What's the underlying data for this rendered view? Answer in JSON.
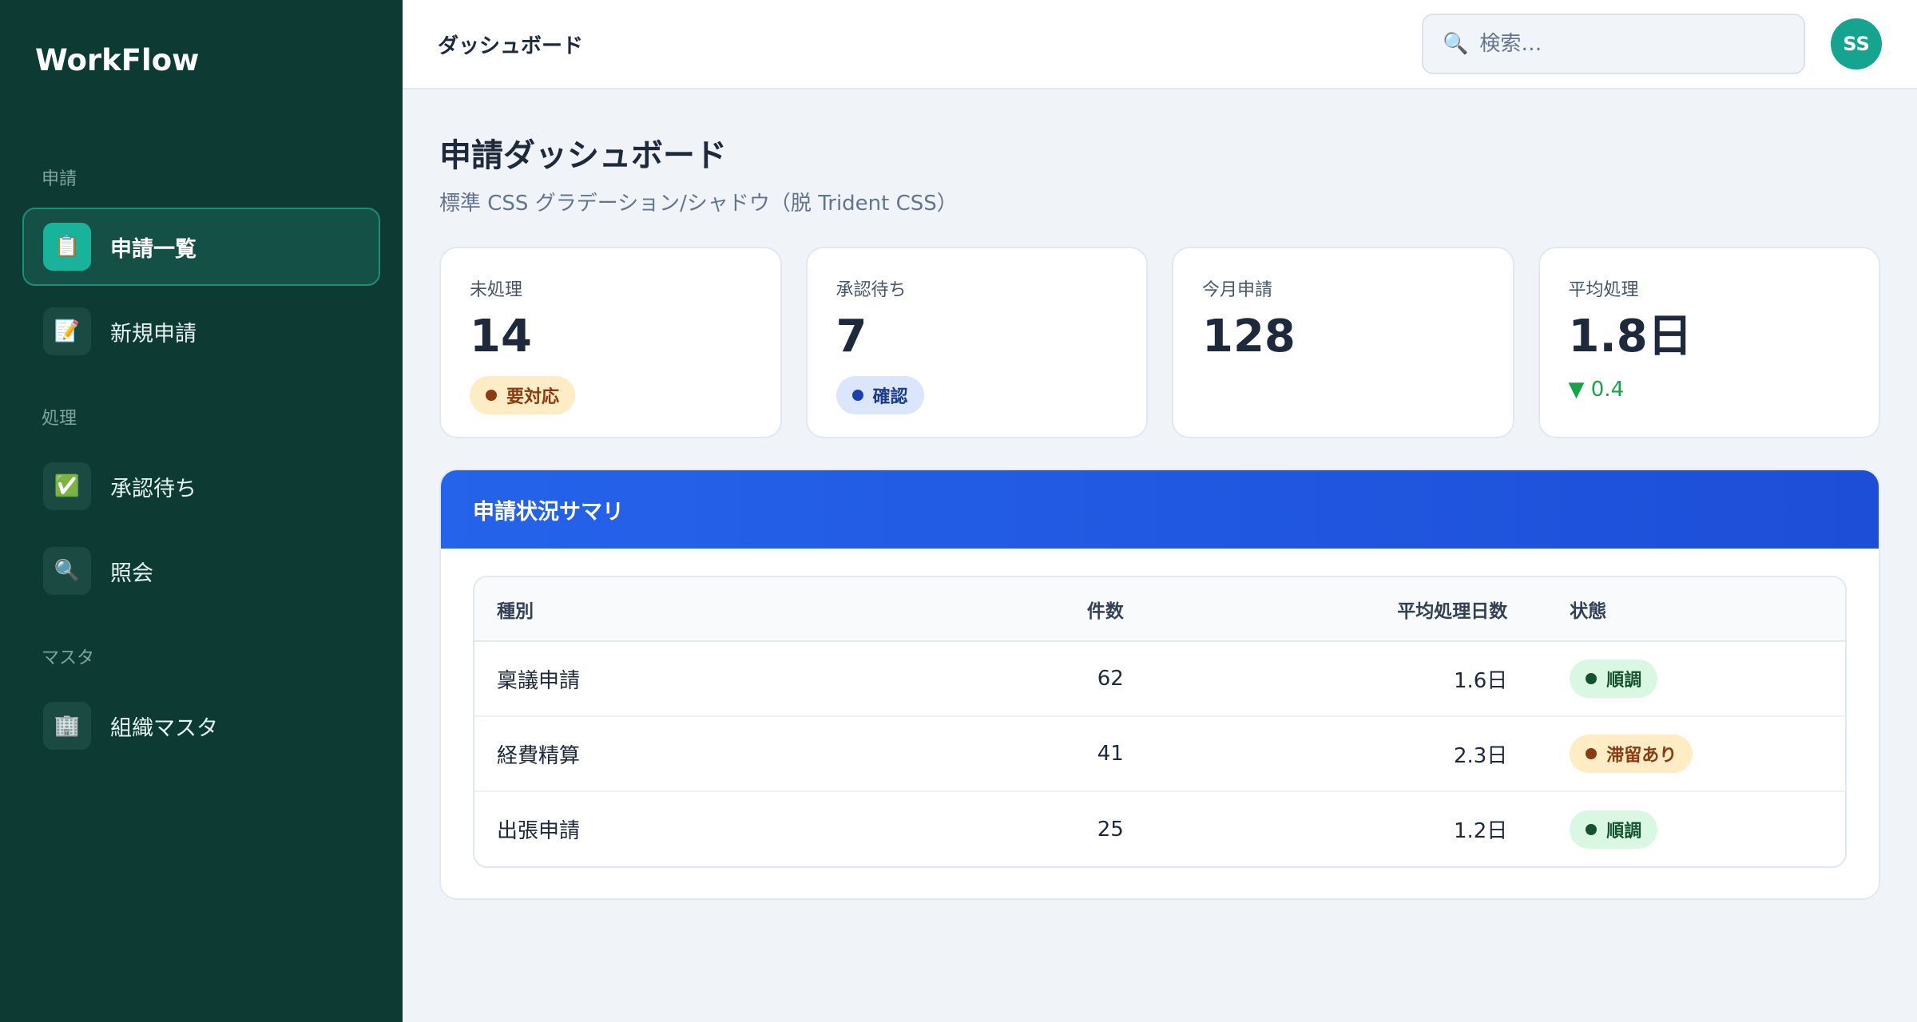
{
  "sidebar": {
    "brand": "WorkFlow",
    "sections": [
      {
        "title": "申請",
        "items": [
          {
            "icon": "📋",
            "icon_name": "clipboard-icon",
            "label": "申請一覧",
            "active": true
          },
          {
            "icon": "📝",
            "icon_name": "memo-icon",
            "label": "新規申請",
            "active": false
          }
        ]
      },
      {
        "title": "処理",
        "items": [
          {
            "icon": "✅",
            "icon_name": "checkmark-icon",
            "label": "承認待ち",
            "active": false
          },
          {
            "icon": "🔍",
            "icon_name": "search-icon",
            "label": "照会",
            "active": false
          }
        ]
      },
      {
        "title": "マスタ",
        "items": [
          {
            "icon": "🏢",
            "icon_name": "building-icon",
            "label": "組織マスタ",
            "active": false
          }
        ]
      }
    ]
  },
  "topbar": {
    "title": "ダッシュボード",
    "search_placeholder": "検索…",
    "avatar_initials": "SS"
  },
  "page": {
    "title": "申請ダッシュボード",
    "subtitle": "標準 CSS グラデーション/シャドウ（脱 Trident CSS）"
  },
  "stats": [
    {
      "label": "未処理",
      "value": "14",
      "badge": "要対応",
      "badge_type": "warn"
    },
    {
      "label": "承認待ち",
      "value": "7",
      "badge": "確認",
      "badge_type": "info"
    },
    {
      "label": "今月申請",
      "value": "128"
    },
    {
      "label": "平均処理",
      "value": "1.8日",
      "trend": "▼ 0.4"
    }
  ],
  "summary": {
    "title": "申請状況サマリ",
    "columns": [
      "種別",
      "件数",
      "平均処理日数",
      "状態"
    ],
    "rows": [
      {
        "type": "稟議申請",
        "count": "62",
        "days": "1.6日",
        "status": "順調",
        "status_type": "ok"
      },
      {
        "type": "経費精算",
        "count": "41",
        "days": "2.3日",
        "status": "滞留あり",
        "status_type": "warn"
      },
      {
        "type": "出張申請",
        "count": "25",
        "days": "1.2日",
        "status": "順調",
        "status_type": "ok"
      }
    ]
  },
  "colors": {
    "sidebar_bg": "#0d3b34",
    "accent_teal": "#18b39b",
    "header_blue": "#2563eb",
    "trend_green": "#16a34a"
  }
}
